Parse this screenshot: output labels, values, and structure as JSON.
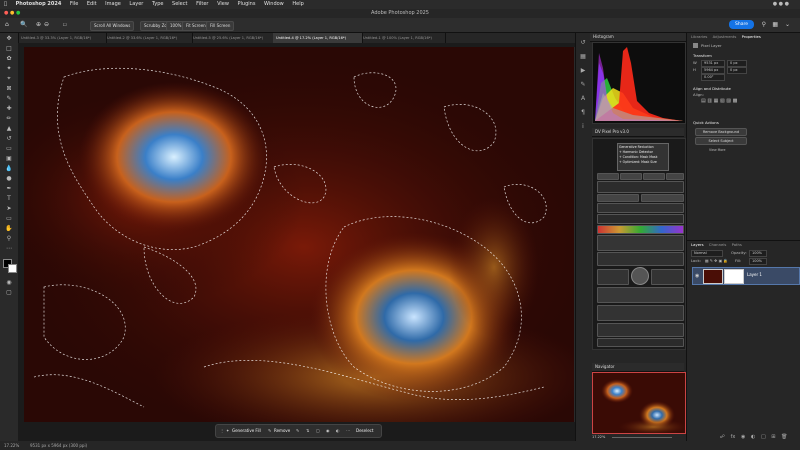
{
  "menubar": {
    "items": [
      "Photoshop 2024",
      "File",
      "Edit",
      "Image",
      "Layer",
      "Type",
      "Select",
      "Filter",
      "View",
      "Plugins",
      "Window",
      "Help"
    ]
  },
  "window": {
    "title": "Adobe Photoshop 2025"
  },
  "options": {
    "scroll_all": "Scroll All Windows",
    "scrubby_zoom": "Scrubby Zoom",
    "zoom_pct": "100%",
    "fit_screen": "Fit Screen",
    "fill_screen": "Fill Screen",
    "share": "Share"
  },
  "tabs": [
    {
      "label": "Untitled-3 @ 33.3% (Layer 1, RGB/16*)"
    },
    {
      "label": "Untitled-2 @ 33.6% (Layer 1, RGB/16*)"
    },
    {
      "label": "Untitled-5 @ 25.6% (Layer 1, RGB/16*)"
    },
    {
      "label": "Untitled-4 @ 17.2% (Layer 1, RGB/16*)"
    },
    {
      "label": "Untitled-1 @ 100% (Layer 1, RGB/16*)"
    }
  ],
  "context": {
    "generative_fill": "Generative Fill",
    "remove": "Remove",
    "deselect": "Deselect"
  },
  "status": {
    "zoom": "17.22%",
    "info": "9531 px x 5964 px (300 ppi)"
  },
  "panels": {
    "histogram": "Histogram",
    "dv_panel": "DV Pixel Pro v3.0",
    "dv_tooltip": [
      "Generative Reduction",
      "+ Harmonic Detector",
      "+ Condition: Mask Mask",
      "+ Optimized: Mask Size"
    ],
    "navigator": "Navigator",
    "nav_zoom": "17.22%"
  },
  "right": {
    "tabs": [
      "Libraries",
      "Adjustments",
      "Properties"
    ],
    "pixel_layer": "Pixel Layer",
    "transform": "Transform",
    "w_value": "9531 px",
    "h_value": "5964 px",
    "x_value": "0 px",
    "y_value": "0 px",
    "angle": "0.00°",
    "align": "Align and Distribute",
    "align_sub": "Align:",
    "quick_actions": "Quick Actions",
    "remove_bg": "Remove Background",
    "select_subject": "Select Subject",
    "view_more": "View More"
  },
  "layers": {
    "tabs": [
      "Layers",
      "Channels",
      "Paths"
    ],
    "mode": "Normal",
    "opacity_label": "Opacity:",
    "opacity": "100%",
    "lock_label": "Lock:",
    "fill_label": "Fill:",
    "fill": "100%",
    "layer_name": "Layer 1"
  },
  "colors": {
    "accent": "#1473e6",
    "nebula_blue": "#3a7fc8",
    "nebula_orange": "#c8611c",
    "space_red": "#5a1208"
  }
}
